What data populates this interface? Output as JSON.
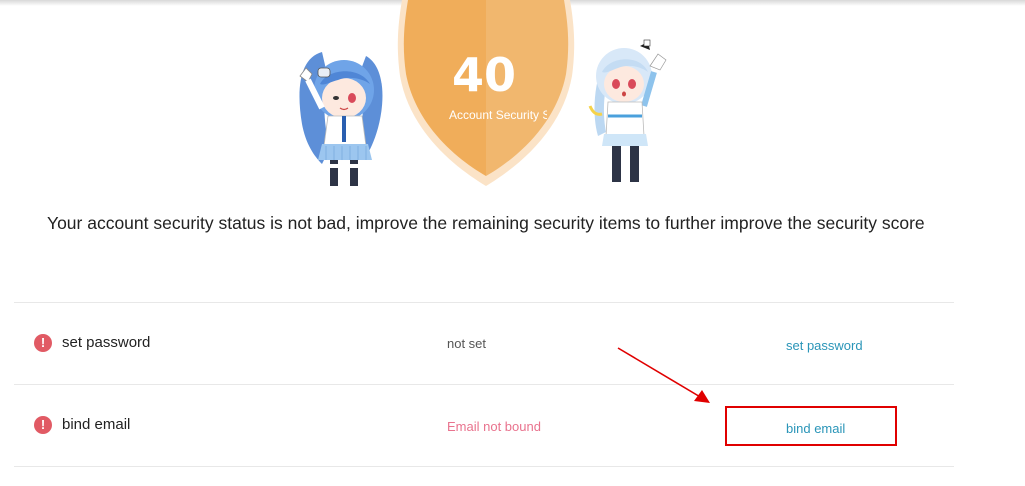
{
  "score": {
    "value": "40",
    "label": "Account Security Score"
  },
  "status_message": "Your account security status is not bad, improve the remaining security items to further improve the security score",
  "security_items": [
    {
      "name": "set password",
      "status": "not set",
      "action": "set password",
      "icon": "exclamation-icon"
    },
    {
      "name": "bind email",
      "status": "Email not bound",
      "action": "bind email",
      "icon": "exclamation-icon"
    }
  ],
  "colors": {
    "shield": "#f0ad5a",
    "warning_icon": "#e15a64",
    "status_warn": "#e9738e",
    "action_link": "#2a95b8",
    "annotation": "#e00000"
  }
}
